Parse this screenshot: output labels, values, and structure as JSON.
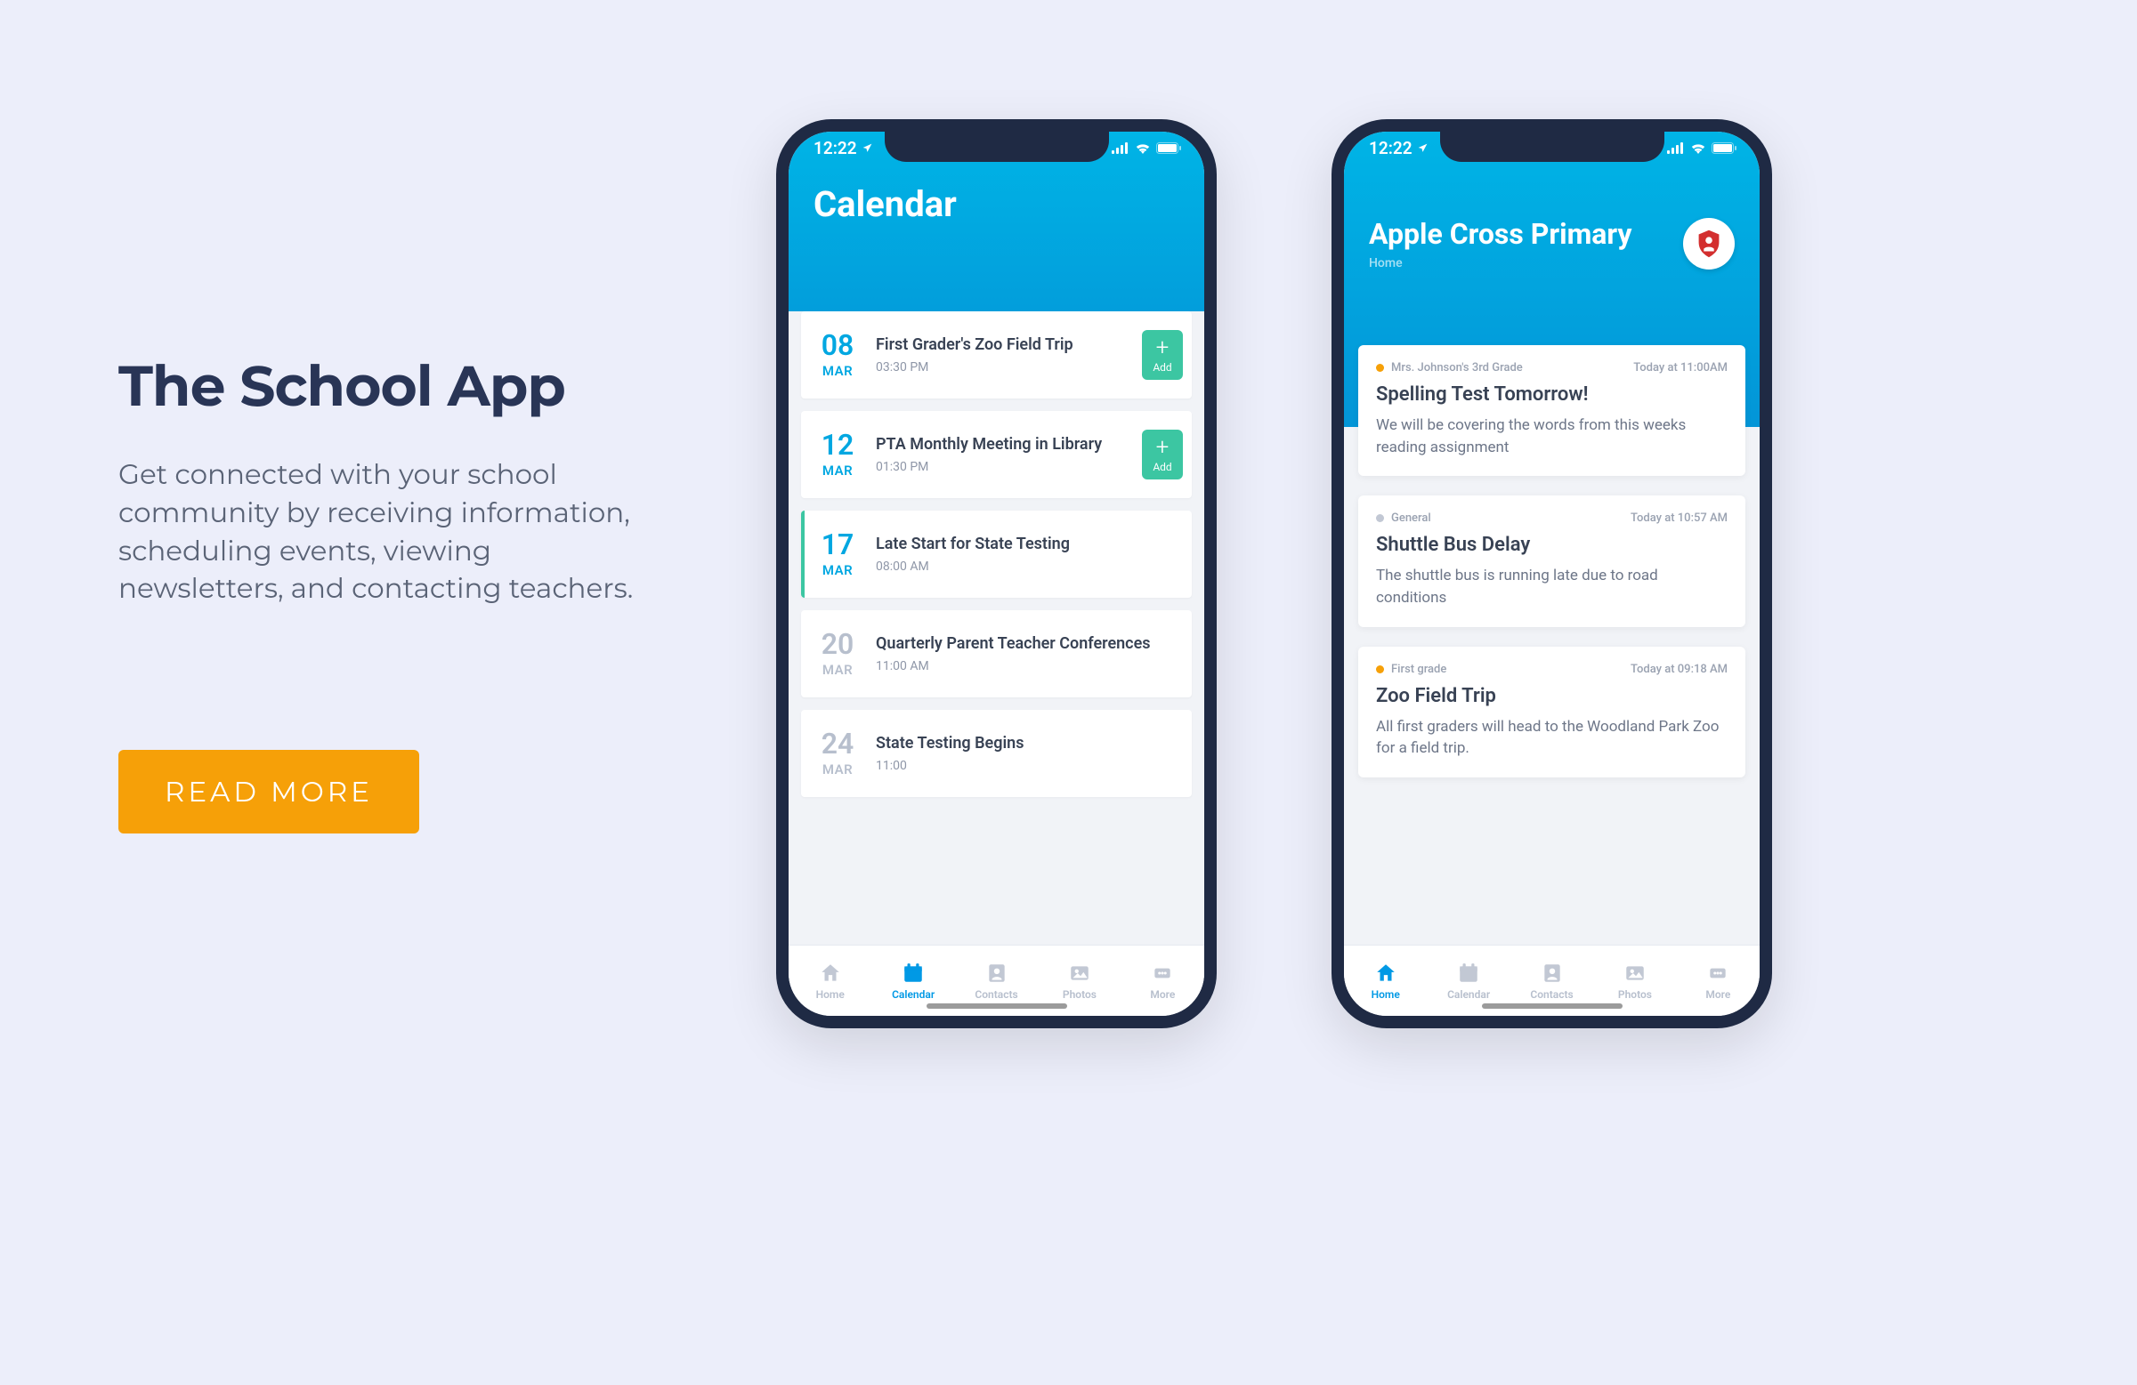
{
  "hero": {
    "title": "The School App",
    "description": "Get connected with your school community by receiving information, scheduling events, viewing newsletters, and contacting teachers.",
    "cta": "READ MORE"
  },
  "status": {
    "time": "12:22"
  },
  "phone1": {
    "header_title": "Calendar",
    "events": [
      {
        "day": "08",
        "month": "MAR",
        "title": "First Grader's Zoo Field Trip",
        "time": "03:30 PM",
        "add_label": "Add",
        "has_add": true,
        "accent": false,
        "muted": false
      },
      {
        "day": "12",
        "month": "MAR",
        "title": "PTA Monthly Meeting in Library",
        "time": "01:30 PM",
        "add_label": "Add",
        "has_add": true,
        "accent": false,
        "muted": false
      },
      {
        "day": "17",
        "month": "MAR",
        "title": "Late Start for State Testing",
        "time": "08:00 AM",
        "has_add": false,
        "accent": true,
        "muted": false
      },
      {
        "day": "20",
        "month": "MAR",
        "title": "Quarterly Parent Teacher Conferences",
        "time": "11:00 AM",
        "has_add": false,
        "accent": false,
        "muted": true
      },
      {
        "day": "24",
        "month": "MAR",
        "title": "State Testing Begins",
        "time": "11:00",
        "has_add": false,
        "accent": false,
        "muted": true
      }
    ],
    "tabs": [
      {
        "id": "home",
        "label": "Home",
        "active": false
      },
      {
        "id": "calendar",
        "label": "Calendar",
        "active": true
      },
      {
        "id": "contacts",
        "label": "Contacts",
        "active": false
      },
      {
        "id": "photos",
        "label": "Photos",
        "active": false
      },
      {
        "id": "more",
        "label": "More",
        "active": false
      }
    ]
  },
  "phone2": {
    "school_name": "Apple Cross Primary",
    "breadcrumb": "Home",
    "posts": [
      {
        "category": "Mrs. Johnson's 3rd Grade",
        "dot": "orange",
        "timestamp": "Today at 11:00AM",
        "title": "Spelling Test Tomorrow!",
        "body": "We will be covering the words from this weeks reading assignment"
      },
      {
        "category": "General",
        "dot": "gray",
        "timestamp": "Today at 10:57 AM",
        "title": "Shuttle Bus Delay",
        "body": "The shuttle bus is running late due to road conditions"
      },
      {
        "category": "First grade",
        "dot": "orange",
        "timestamp": "Today at 09:18 AM",
        "title": "Zoo Field Trip",
        "body": "All first graders will head to the Woodland Park Zoo for a field trip."
      }
    ],
    "tabs": [
      {
        "id": "home",
        "label": "Home",
        "active": true
      },
      {
        "id": "calendar",
        "label": "Calendar",
        "active": false
      },
      {
        "id": "contacts",
        "label": "Contacts",
        "active": false
      },
      {
        "id": "photos",
        "label": "Photos",
        "active": false
      },
      {
        "id": "more",
        "label": "More",
        "active": false
      }
    ]
  },
  "colors": {
    "accent_orange": "#f6a008",
    "brand_blue": "#0099e5",
    "green": "#3cc6a2",
    "navy": "#293556"
  }
}
